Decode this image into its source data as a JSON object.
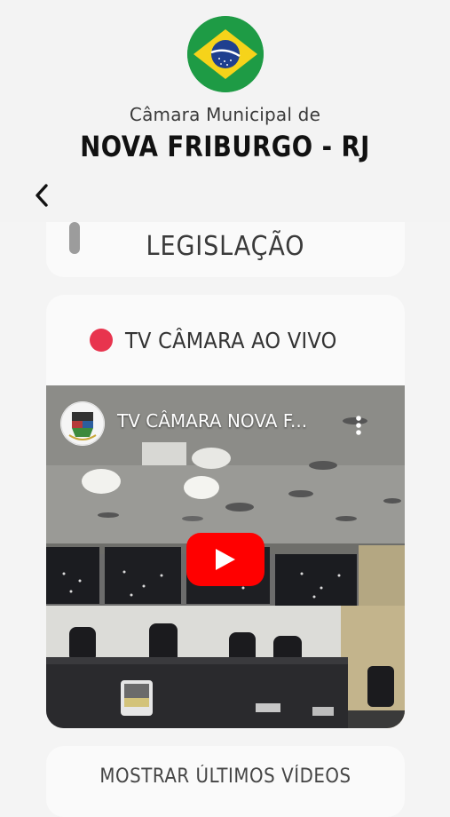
{
  "header": {
    "subtitle": "Câmara Municipal de",
    "title": "NOVA FRIBURGO - RJ",
    "flag_icon": "brazil-flag-icon",
    "back_icon": "chevron-left-icon"
  },
  "legislation_card": {
    "label": "LEGISLAÇÃO"
  },
  "tv_card": {
    "live_label": "TV CÂMARA AO VIVO",
    "live_color": "#e8344e",
    "video": {
      "channel_title": "TV CÂMARA NOVA F...",
      "more_icon": "more-vertical-icon",
      "play_icon": "youtube-play-icon",
      "play_color": "#ff0000"
    }
  },
  "more_videos": {
    "label": "MOSTRAR ÚLTIMOS VÍDEOS"
  }
}
